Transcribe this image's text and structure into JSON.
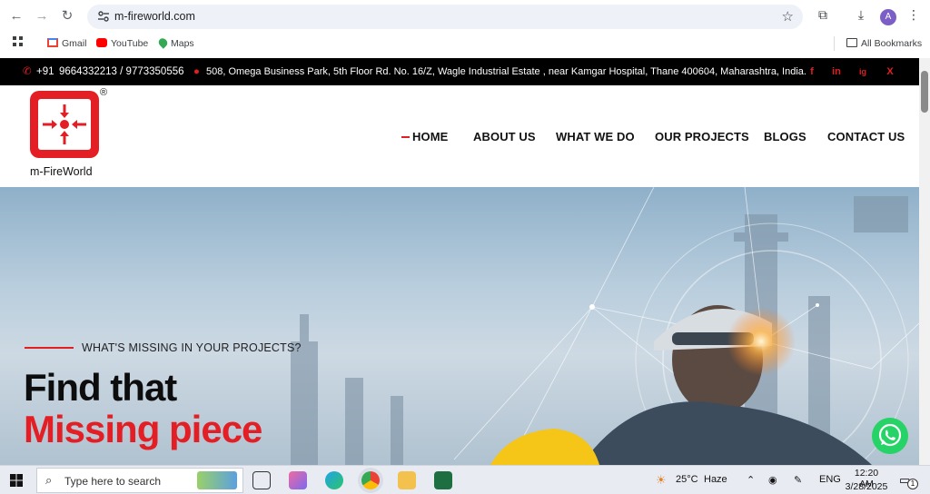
{
  "browser": {
    "url": "m-fireworld.com",
    "profile_initial": "A",
    "bookmarks": [
      "Gmail",
      "YouTube",
      "Maps"
    ],
    "all_bookmarks": "All Bookmarks"
  },
  "topbar": {
    "phone_prefix": "+91",
    "phone": "9664332213 / 9773350556",
    "address": "508, Omega Business Park, 5th Floor Rd. No. 16/Z, Wagle Industrial Estate , near Kamgar Hospital, Thane 400604, Maharashtra, India.",
    "social": [
      "f",
      "in",
      "ig",
      "X"
    ]
  },
  "logo": {
    "text": "m-FireWorld",
    "registered": "®"
  },
  "nav": [
    "HOME",
    "ABOUT US",
    "WHAT WE DO",
    "OUR PROJECTS",
    "BLOGS",
    "CONTACT US"
  ],
  "hero": {
    "kicker": "WHAT'S MISSING IN YOUR PROJECTS?",
    "line1": "Find that",
    "line2": "Missing piece"
  },
  "taskbar": {
    "search_placeholder": "Type here to search",
    "weather_temp": "25°C",
    "weather_desc": "Haze",
    "lang": "ENG",
    "time": "12:20 AM",
    "date": "3/28/2025",
    "notif_count": "1"
  },
  "colors": {
    "brand_red": "#e31e24",
    "topbar_bg": "#000000",
    "whatsapp": "#25d366"
  }
}
